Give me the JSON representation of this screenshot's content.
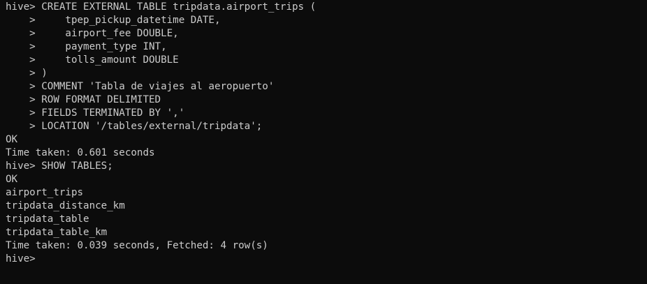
{
  "terminal": {
    "background": "#0c0c0c",
    "foreground": "#cccccc",
    "lines": [
      "hive> CREATE EXTERNAL TABLE tripdata.airport_trips (",
      "    >     tpep_pickup_datetime DATE,",
      "    >     airport_fee DOUBLE,",
      "    >     payment_type INT,",
      "    >     tolls_amount DOUBLE",
      "    > )",
      "    > COMMENT 'Tabla de viajes al aeropuerto'",
      "    > ROW FORMAT DELIMITED",
      "    > FIELDS TERMINATED BY ','",
      "    > LOCATION '/tables/external/tripdata';",
      "OK",
      "Time taken: 0.601 seconds",
      "hive> SHOW TABLES;",
      "OK",
      "airport_trips",
      "tripdata_distance_km",
      "tripdata_table",
      "tripdata_table_km",
      "Time taken: 0.039 seconds, Fetched: 4 row(s)",
      "hive>"
    ]
  }
}
